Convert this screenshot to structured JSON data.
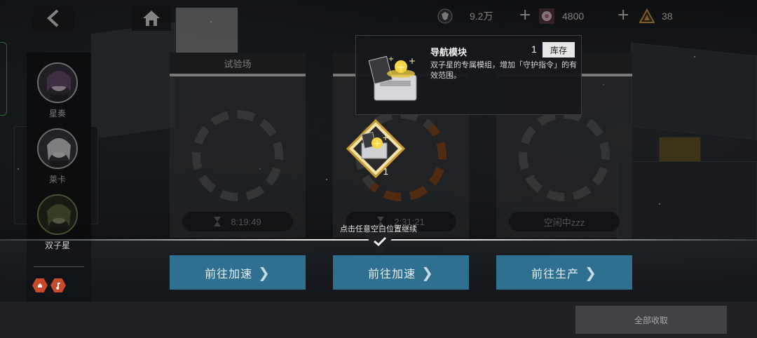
{
  "resources": [
    {
      "icon": "shield-emblem-icon",
      "value": "9.2万"
    },
    {
      "icon": "flower-badge-icon",
      "value": "4800"
    },
    {
      "icon": "triangle-emblem-icon",
      "value": "38"
    }
  ],
  "characters": [
    {
      "name": "星奏"
    },
    {
      "name": "莱卡"
    },
    {
      "name": "双子星"
    }
  ],
  "cards": [
    {
      "title": "试验场",
      "timer": "8:19:49",
      "action": "前往加速"
    },
    {
      "title": "",
      "timer": "2:31:21",
      "action": "前往加速"
    },
    {
      "title": "",
      "timer": "空闲中zzz",
      "action": "前往生产"
    }
  ],
  "reward": {
    "count": "1"
  },
  "tooltip": {
    "title": "导航模块",
    "quantity": "1",
    "stock_label": "库存",
    "description": "双子星的专属模组，增加「守护指令」的有效范围。"
  },
  "continue_hint": "点击任意空白位置继续",
  "collect_all": "全部收取",
  "colors": {
    "action": "#2f6f8f",
    "accent_gold": "#e8c840"
  }
}
